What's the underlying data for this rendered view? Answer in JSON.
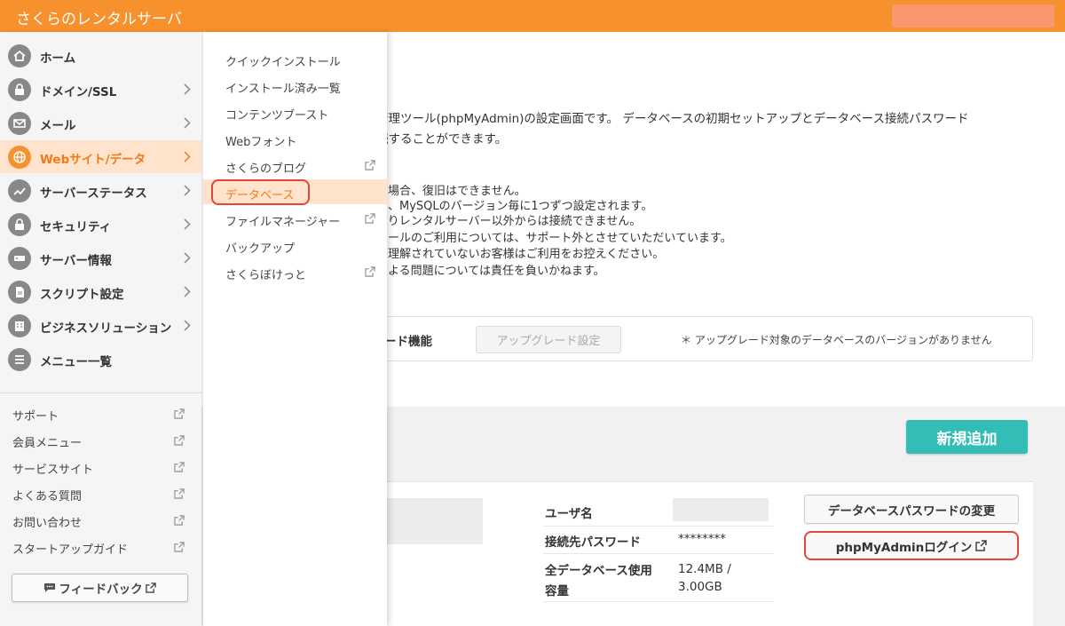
{
  "header": {
    "brand": "さくらのレンタルサーバ"
  },
  "sidebar": {
    "items": [
      {
        "label": "ホーム",
        "icon": "home-icon",
        "chevron": false
      },
      {
        "label": "ドメイン/SSL",
        "icon": "lock-icon",
        "chevron": true
      },
      {
        "label": "メール",
        "icon": "mail-icon",
        "chevron": true
      },
      {
        "label": "Webサイト/データ",
        "icon": "globe-icon",
        "chevron": true,
        "active": true
      },
      {
        "label": "サーバーステータス",
        "icon": "chart-icon",
        "chevron": true
      },
      {
        "label": "セキュリティ",
        "icon": "padlock-icon",
        "chevron": true
      },
      {
        "label": "サーバー情報",
        "icon": "server-icon",
        "chevron": true
      },
      {
        "label": "スクリプト設定",
        "icon": "script-icon",
        "chevron": true
      },
      {
        "label": "ビジネスソリューション",
        "icon": "business-icon",
        "chevron": true
      },
      {
        "label": "メニュー一覧",
        "icon": "list-icon",
        "chevron": false
      }
    ],
    "links": [
      "サポート",
      "会員メニュー",
      "サービスサイト",
      "よくある質問",
      "お問い合わせ",
      "スタートアップガイド"
    ],
    "feedback_label": "フィードバック"
  },
  "submenu": {
    "items": [
      {
        "label": "クイックインストール",
        "external": false
      },
      {
        "label": "インストール済み一覧",
        "external": false
      },
      {
        "label": "コンテンツブースト",
        "external": false
      },
      {
        "label": "Webフォント",
        "external": false
      },
      {
        "label": "さくらのブログ",
        "external": true
      },
      {
        "label": "データベース",
        "external": false,
        "active": true
      },
      {
        "label": "ファイルマネージャー",
        "external": true
      },
      {
        "label": "バックアップ",
        "external": false
      },
      {
        "label": "さくらぼけっと",
        "external": true
      }
    ]
  },
  "main": {
    "description_lines": [
      "管理ツール(phpMyAdmin)の設定画面です。 データベースの初期セットアップとデータベース接続パスワード",
      "続することができます。"
    ],
    "notes": [
      "た場合、復旧はできません。",
      "は、MySQLのバージョン毎に1つずつ設定されます。",
      "よりレンタルサーバー以外からは接続できません。",
      "ツールのご利用については、サポート外とさせていただいています。",
      "を理解されていないお客様はご利用をお控えください。",
      "による問題については責任を負いかねます。"
    ],
    "upgrade": {
      "label": "ード機能",
      "button": "アップグレード設定",
      "note": "＊ アップグレード対象のデータベースのバージョンがありません"
    },
    "new_add_button": "新規追加",
    "db_info": {
      "username_label": "ユーザ名",
      "password_label": "接続先パスワード",
      "password_value": "********",
      "usage_label_1": "全データベース使用",
      "usage_label_2": "容量",
      "usage_value_1": "12.4MB /",
      "usage_value_2": "3.00GB"
    },
    "pw_change_button": "データベースパスワードの変更",
    "pma_login_button": "phpMyAdminログイン"
  },
  "colors": {
    "brand_orange": "#f7912e",
    "active_bg": "#ffe3cc",
    "teal": "#33bdb7",
    "highlight_red": "#e2463c"
  }
}
